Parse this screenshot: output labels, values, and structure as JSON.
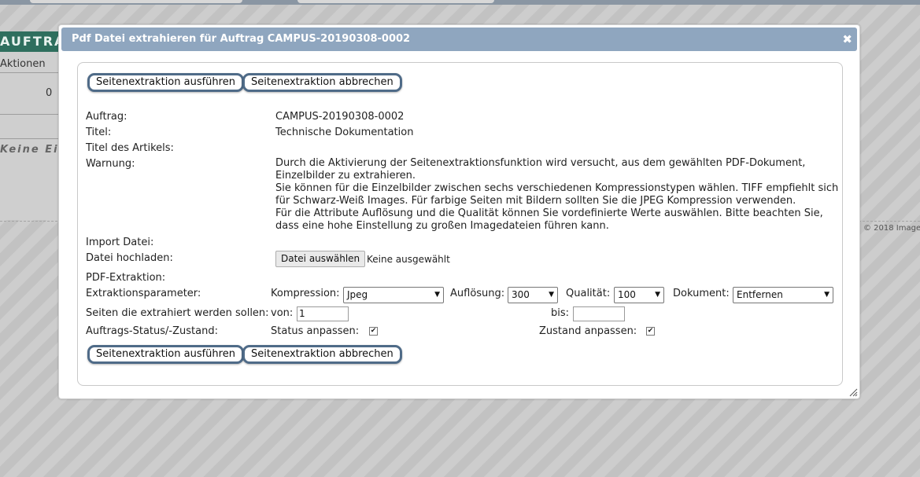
{
  "background": {
    "heading": "AUFTRA",
    "column_label": "Aktionen",
    "count": "0",
    "empty_text": "Keine Ei",
    "copyright": "© 2018 Image"
  },
  "dialog": {
    "title": "Pdf Datei extrahieren für Auftrag CAMPUS-20190308-0002",
    "close_symbol": "✖",
    "run_button": "Seitenextraktion ausführen",
    "cancel_button": "Seitenextraktion abbrechen",
    "fields": {
      "auftrag_label": "Auftrag:",
      "auftrag_value": "CAMPUS-20190308-0002",
      "titel_label": "Titel:",
      "titel_value": "Technische Dokumentation",
      "artikel_label": "Titel des Artikels:",
      "warnung_label": "Warnung:",
      "warnung_lines": [
        "Durch die Aktivierung der Seitenextraktionsfunktion wird versucht, aus dem gewählten PDF-Dokument,",
        "Einzelbilder zu extrahieren.",
        "Sie können für die Einzelbilder zwischen sechs verschiedenen Kompressionstypen wählen. TIFF empfiehlt sich",
        "für Schwarz-Weiß Images. Für farbige Seiten mit Bildern sollten Sie die JPEG Kompression verwenden.",
        "Für die Attribute Auflösung und die Qualität können Sie vordefinierte Werte auswählen. Bitte beachten Sie,",
        "dass eine hohe Einstellung zu großen Imagedateien führen kann."
      ],
      "import_label": "Import Datei:",
      "upload_label": "Datei hochladen:",
      "file_button": "Datei auswählen",
      "file_status": "Keine ausgewählt",
      "pdf_label": "PDF-Extraktion:",
      "params_label": "Extraktionsparameter:",
      "kompression_label": "Kompression:",
      "kompression_value": "Jpeg",
      "aufloesung_label": "Auflösung:",
      "aufloesung_value": "300",
      "qualitaet_label": "Qualität:",
      "qualitaet_value": "100",
      "dokument_label": "Dokument:",
      "dokument_value": "Entfernen",
      "pages_label": "Seiten die extrahiert werden sollen:",
      "von_label": "von:",
      "von_value": "1",
      "bis_label": "bis:",
      "bis_value": "",
      "status_row_label": "Auftrags-Status/-Zustand:",
      "status_label": "Status anpassen:",
      "status_checked": true,
      "zustand_label": "Zustand anpassen:",
      "zustand_checked": true
    }
  }
}
